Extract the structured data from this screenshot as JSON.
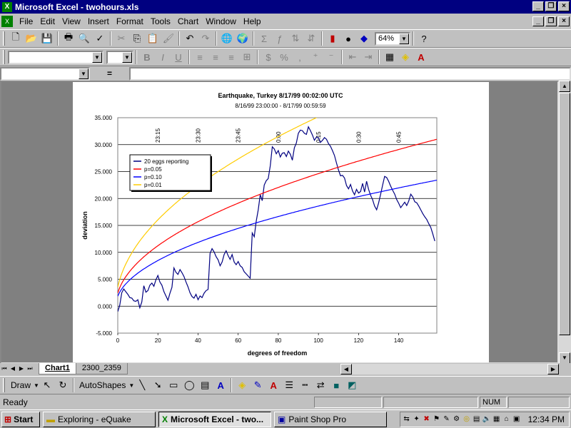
{
  "window": {
    "title": "Microsoft Excel - twohours.xls"
  },
  "menu": {
    "items": [
      "File",
      "Edit",
      "View",
      "Insert",
      "Format",
      "Tools",
      "Chart",
      "Window",
      "Help"
    ]
  },
  "toolbar": {
    "zoom": "64%"
  },
  "formula_bar": {
    "equals": "="
  },
  "chart_data": {
    "type": "line",
    "title": "Earthquake, Turkey 8/17/99 00:02:00 UTC",
    "subtitle": "8/16/99 23:00:00 - 8/17/99 00:59:59",
    "xlabel": "degrees of freedom",
    "ylabel": "deviation",
    "xlim": [
      0,
      159
    ],
    "ylim": [
      -5000,
      35000
    ],
    "x_ticks": [
      "0",
      "20",
      "40",
      "60",
      "80",
      "100",
      "120",
      "140"
    ],
    "x_tick_values": [
      0,
      20,
      40,
      60,
      80,
      100,
      120,
      140
    ],
    "y_ticks": [
      "-5.000",
      "0.000",
      "5.000",
      "10.000",
      "15.000",
      "20.000",
      "25.000",
      "30.000",
      "35.000"
    ],
    "y_tick_values": [
      -5000,
      0,
      5000,
      10000,
      15000,
      20000,
      25000,
      30000,
      35000
    ],
    "top_axis_ticks": [
      {
        "label": "23:15",
        "x": 20
      },
      {
        "label": "23:30",
        "x": 40
      },
      {
        "label": "23:45",
        "x": 60
      },
      {
        "label": "0:00",
        "x": 80
      },
      {
        "label": "0:15",
        "x": 100
      },
      {
        "label": "0:30",
        "x": 120
      },
      {
        "label": "0:45",
        "x": 140
      }
    ],
    "grid": "horizontal",
    "legend_position": "top-left",
    "series": [
      {
        "name": "20 eggs reporting",
        "color": "#000080",
        "kind": "walk",
        "points": [
          [
            0,
            -1000
          ],
          [
            1,
            200
          ],
          [
            2,
            2500
          ],
          [
            3,
            3200
          ],
          [
            4,
            2700
          ],
          [
            5,
            2200
          ],
          [
            6,
            1600
          ],
          [
            7,
            1500
          ],
          [
            8,
            1000
          ],
          [
            9,
            900
          ],
          [
            10,
            1200
          ],
          [
            11,
            -300
          ],
          [
            12,
            800
          ],
          [
            13,
            3800
          ],
          [
            14,
            2600
          ],
          [
            15,
            2900
          ],
          [
            16,
            3900
          ],
          [
            17,
            4300
          ],
          [
            18,
            3700
          ],
          [
            19,
            4900
          ],
          [
            20,
            5700
          ],
          [
            21,
            4500
          ],
          [
            22,
            3900
          ],
          [
            23,
            2700
          ],
          [
            24,
            1900
          ],
          [
            25,
            1100
          ],
          [
            26,
            2400
          ],
          [
            27,
            3500
          ],
          [
            28,
            7100
          ],
          [
            29,
            6300
          ],
          [
            30,
            5900
          ],
          [
            31,
            6800
          ],
          [
            32,
            6200
          ],
          [
            33,
            5500
          ],
          [
            34,
            4500
          ],
          [
            35,
            3600
          ],
          [
            36,
            2500
          ],
          [
            37,
            1800
          ],
          [
            38,
            1500
          ],
          [
            39,
            2200
          ],
          [
            40,
            1200
          ],
          [
            41,
            1900
          ],
          [
            42,
            1600
          ],
          [
            43,
            2400
          ],
          [
            44,
            2900
          ],
          [
            45,
            3100
          ],
          [
            46,
            9800
          ],
          [
            47,
            10700
          ],
          [
            48,
            10100
          ],
          [
            49,
            9200
          ],
          [
            50,
            8600
          ],
          [
            51,
            7500
          ],
          [
            52,
            8200
          ],
          [
            53,
            9600
          ],
          [
            54,
            10300
          ],
          [
            55,
            9400
          ],
          [
            56,
            8700
          ],
          [
            57,
            9600
          ],
          [
            58,
            8200
          ],
          [
            59,
            7700
          ],
          [
            60,
            8300
          ],
          [
            61,
            7500
          ],
          [
            62,
            7200
          ],
          [
            63,
            6400
          ],
          [
            64,
            6000
          ],
          [
            65,
            5600
          ],
          [
            66,
            5200
          ],
          [
            67,
            13600
          ],
          [
            68,
            12900
          ],
          [
            69,
            15800
          ],
          [
            70,
            17900
          ],
          [
            71,
            20700
          ],
          [
            72,
            19600
          ],
          [
            73,
            22500
          ],
          [
            74,
            23300
          ],
          [
            75,
            23700
          ],
          [
            76,
            26100
          ],
          [
            77,
            29600
          ],
          [
            78,
            29200
          ],
          [
            79,
            28300
          ],
          [
            80,
            28900
          ],
          [
            81,
            27700
          ],
          [
            82,
            28400
          ],
          [
            83,
            28500
          ],
          [
            84,
            27800
          ],
          [
            85,
            28800
          ],
          [
            86,
            28200
          ],
          [
            87,
            27100
          ],
          [
            88,
            29400
          ],
          [
            89,
            30300
          ],
          [
            90,
            32100
          ],
          [
            91,
            32700
          ],
          [
            92,
            32600
          ],
          [
            93,
            32100
          ],
          [
            94,
            31900
          ],
          [
            95,
            33300
          ],
          [
            96,
            32600
          ],
          [
            97,
            31800
          ],
          [
            98,
            30800
          ],
          [
            99,
            31400
          ],
          [
            100,
            31300
          ],
          [
            101,
            30400
          ],
          [
            102,
            30800
          ],
          [
            103,
            31300
          ],
          [
            104,
            31000
          ],
          [
            105,
            30200
          ],
          [
            106,
            29700
          ],
          [
            107,
            28900
          ],
          [
            108,
            28000
          ],
          [
            109,
            26600
          ],
          [
            110,
            25300
          ],
          [
            111,
            24200
          ],
          [
            112,
            24300
          ],
          [
            113,
            23800
          ],
          [
            114,
            22400
          ],
          [
            115,
            21800
          ],
          [
            116,
            22600
          ],
          [
            117,
            21400
          ],
          [
            118,
            20700
          ],
          [
            119,
            21700
          ],
          [
            120,
            21000
          ],
          [
            121,
            21300
          ],
          [
            122,
            22800
          ],
          [
            123,
            21200
          ],
          [
            124,
            23200
          ],
          [
            125,
            21700
          ],
          [
            126,
            20600
          ],
          [
            127,
            19800
          ],
          [
            128,
            18600
          ],
          [
            129,
            17900
          ],
          [
            130,
            19200
          ],
          [
            131,
            20800
          ],
          [
            132,
            22500
          ],
          [
            133,
            24100
          ],
          [
            134,
            23900
          ],
          [
            135,
            23200
          ],
          [
            136,
            22300
          ],
          [
            137,
            21500
          ],
          [
            138,
            20800
          ],
          [
            139,
            19800
          ],
          [
            140,
            19100
          ],
          [
            141,
            18300
          ],
          [
            142,
            18800
          ],
          [
            143,
            19300
          ],
          [
            144,
            18700
          ],
          [
            145,
            19500
          ],
          [
            146,
            20800
          ],
          [
            147,
            20300
          ],
          [
            148,
            19400
          ],
          [
            149,
            19200
          ],
          [
            150,
            18600
          ],
          [
            151,
            17900
          ],
          [
            152,
            17200
          ],
          [
            153,
            16600
          ],
          [
            154,
            16100
          ],
          [
            155,
            15300
          ],
          [
            156,
            14600
          ],
          [
            157,
            13400
          ],
          [
            158,
            12100
          ]
        ]
      },
      {
        "name": "p=0.05",
        "color": "#ff0000",
        "kind": "curve",
        "coef": 2450
      },
      {
        "name": "p=0.10",
        "color": "#0000ff",
        "kind": "curve",
        "coef": 1850
      },
      {
        "name": "p=0.01",
        "color": "#ffcc00",
        "kind": "curve",
        "coef": 3500
      }
    ]
  },
  "sheet_tabs": [
    "Chart1",
    "2300_2359"
  ],
  "drawing": {
    "draw": "Draw",
    "autoshapes": "AutoShapes"
  },
  "status": {
    "text": "Ready",
    "num": "NUM"
  },
  "taskbar": {
    "start": "Start",
    "tasks": [
      "Exploring - eQuake",
      "Microsoft Excel - two...",
      "Paint Shop Pro"
    ],
    "clock": "12:34 PM"
  }
}
